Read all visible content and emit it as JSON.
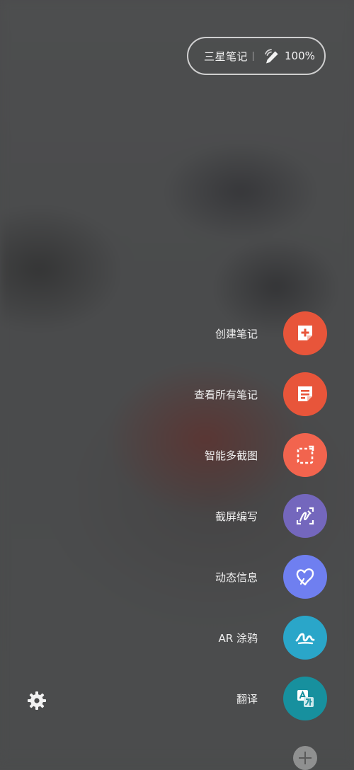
{
  "status_pill": {
    "app_name": "三星笔记",
    "pen_icon": "s-pen-signal-icon",
    "battery": "100%"
  },
  "menu": {
    "items": [
      {
        "label": "创建笔记",
        "icon": "create-note-icon",
        "color": "#e8553a"
      },
      {
        "label": "查看所有笔记",
        "icon": "view-notes-icon",
        "color": "#e8553a"
      },
      {
        "label": "智能多截图",
        "icon": "smart-select-icon",
        "color": "#f2644e"
      },
      {
        "label": "截屏编写",
        "icon": "screen-write-icon",
        "color": "#7467bd"
      },
      {
        "label": "动态信息",
        "icon": "live-message-icon",
        "color": "#6f7ff0"
      },
      {
        "label": "AR 涂鸦",
        "icon": "ar-doodle-icon",
        "color": "#2aa6c9"
      },
      {
        "label": "翻译",
        "icon": "translate-icon",
        "color": "#17909e"
      }
    ]
  },
  "settings": {
    "icon": "gear-icon"
  },
  "add": {
    "icon": "plus-icon"
  }
}
